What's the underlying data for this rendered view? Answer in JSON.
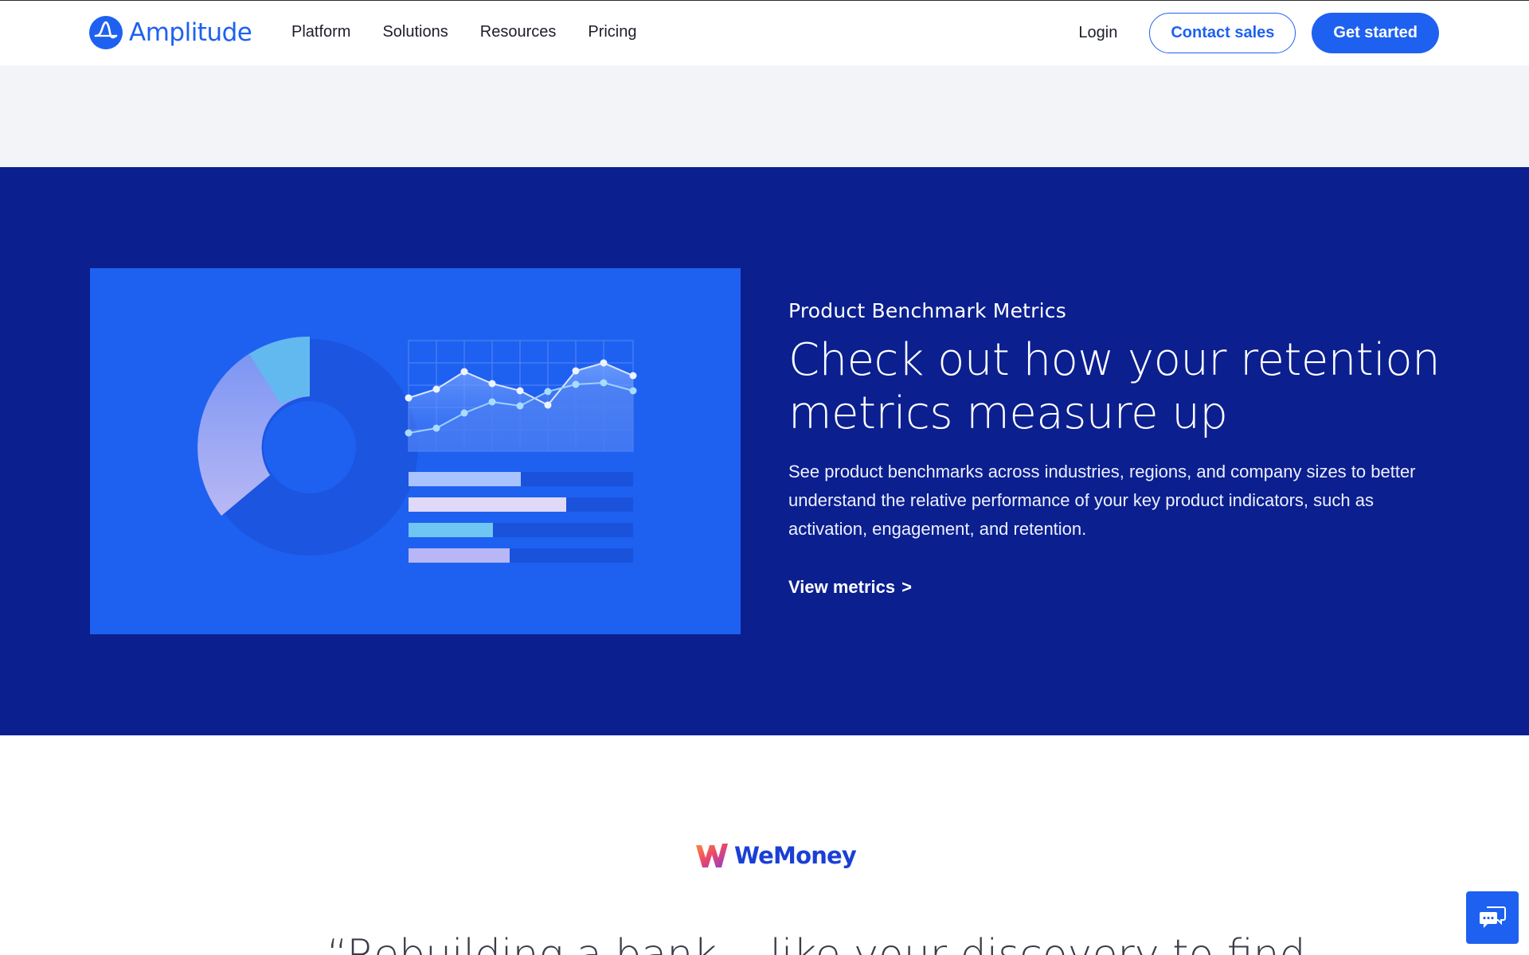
{
  "nav": {
    "brand": "Amplitude",
    "links": [
      "Platform",
      "Solutions",
      "Resources",
      "Pricing"
    ],
    "login": "Login",
    "contact_sales": "Contact sales",
    "get_started": "Get started"
  },
  "feature": {
    "eyebrow": "Product Benchmark Metrics",
    "headline": "Check out how your retention metrics measure up",
    "description": "See product benchmarks across industries, regions, and company sizes to better understand the relative performance of your key product indicators, such as activation, engagement, and retention.",
    "cta": "View metrics",
    "cta_arrow": ">"
  },
  "customer": {
    "logo_text": "WeMoney",
    "quote_partial": "“Rebuilding a bank... like your discovery to find ..."
  },
  "colors": {
    "brand_blue": "#1e61f0",
    "navy": "#0b1f8f",
    "grey_band": "#f3f4f8"
  },
  "icons": {
    "logo": "amplitude-logo-icon",
    "chat": "chat-bubbles-icon"
  }
}
